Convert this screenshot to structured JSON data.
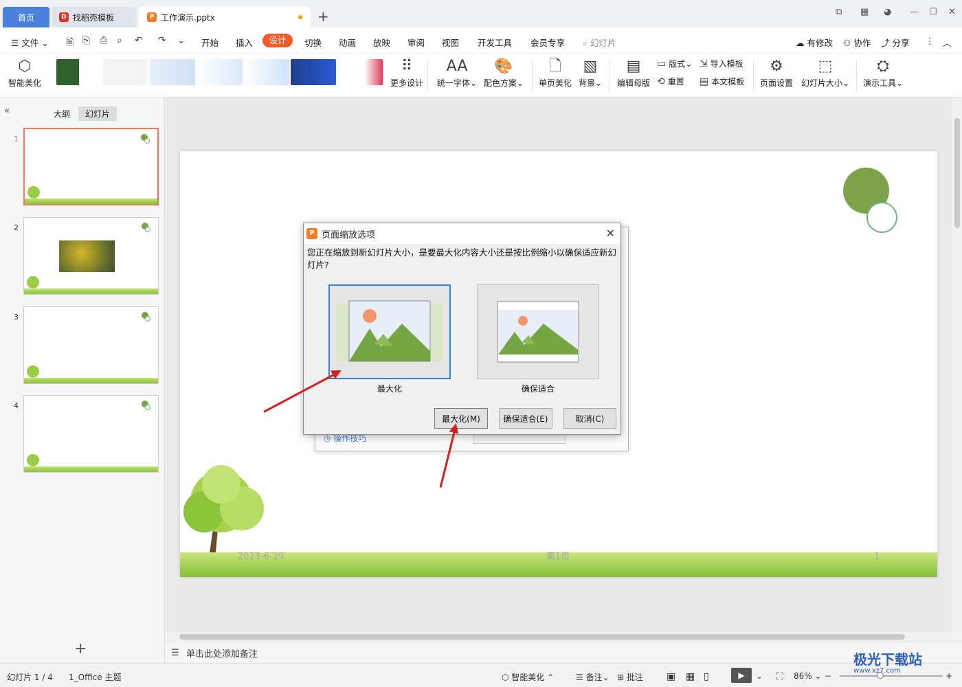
{
  "tabs": {
    "home": "首页",
    "template": "找稻壳模板",
    "doc": "工作演示.pptx"
  },
  "menu": {
    "file": "文件",
    "items": [
      "开始",
      "插入",
      "设计",
      "切换",
      "动画",
      "放映",
      "审阅",
      "视图",
      "开发工具",
      "会员专享"
    ],
    "search_placeholder": "幻灯片",
    "right": [
      "有修改",
      "协作",
      "分享"
    ]
  },
  "ribbon": {
    "smart_beautify": "智能美化",
    "more_design": "更多设计",
    "unify_font": "统一字体",
    "color_scheme": "配色方案",
    "single_page": "单页美化",
    "background": "背景",
    "edit_master": "编辑母版",
    "layout": "版式",
    "reset": "重置",
    "import_template": "导入模板",
    "this_template": "本文模板",
    "page_setup": "页面设置",
    "slide_size": "幻灯片大小",
    "present_tools": "演示工具"
  },
  "left_panel": {
    "outline_tab": "大纲",
    "slides_tab": "幻灯片",
    "slide_numbers": [
      "1",
      "2",
      "3",
      "4"
    ]
  },
  "slide": {
    "date": "2023-6-29",
    "page": "第1页",
    "number": "1"
  },
  "notes_placeholder": "单击此处添加备注",
  "background_dialog": {
    "tip": "操作技巧"
  },
  "dialog": {
    "title": "页面缩放选项",
    "message": "您正在缩放到新幻灯片大小，是要最大化内容大小还是按比例缩小以确保适应新幻灯片?",
    "option_maximize": "最大化",
    "option_fit": "确保适合",
    "btn_maximize": "最大化(M)",
    "btn_fit": "确保适合(E)",
    "btn_cancel": "取消(C)"
  },
  "status": {
    "slide_info": "幻灯片 1 / 4",
    "theme": "1_Office 主题",
    "smart_beautify": "智能美化",
    "notes": "备注",
    "comments": "批注",
    "zoom": "86%"
  },
  "watermark": {
    "name": "极光下载站",
    "url": "www.xz7.com"
  },
  "colors": {
    "accent": "#f25d2a",
    "home_tab": "#4d7fdd",
    "selection": "#3b7fcf",
    "arrow": "#d61e1e",
    "slide_green": "#7ca34a"
  }
}
